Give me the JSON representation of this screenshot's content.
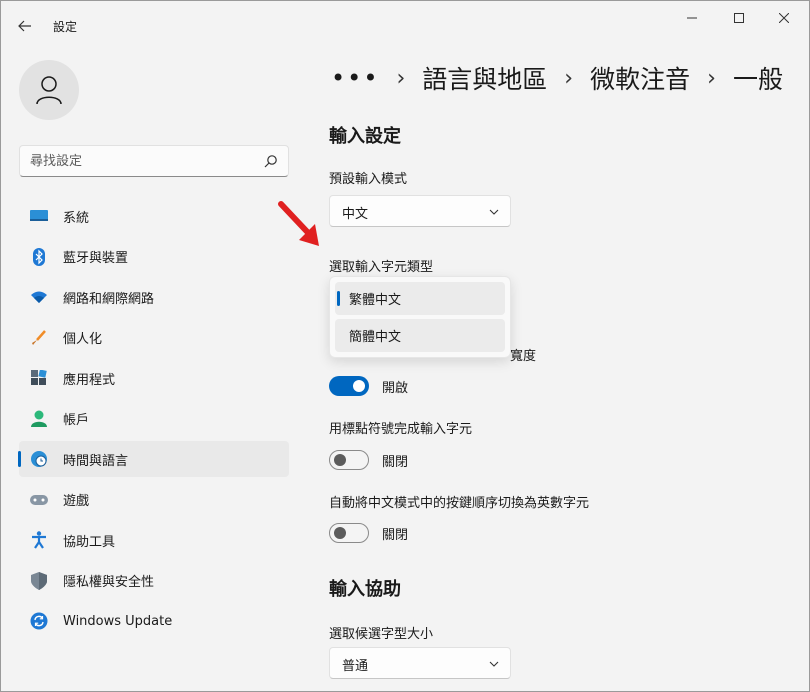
{
  "window": {
    "app_title": "設定",
    "accent": "#0067c0"
  },
  "sidebar": {
    "search_placeholder": "尋找設定",
    "items": [
      {
        "label": "系統",
        "icon": "monitor-icon"
      },
      {
        "label": "藍牙與裝置",
        "icon": "bluetooth-icon"
      },
      {
        "label": "網路和網際網路",
        "icon": "wifi-icon"
      },
      {
        "label": "個人化",
        "icon": "brush-icon"
      },
      {
        "label": "應用程式",
        "icon": "apps-icon"
      },
      {
        "label": "帳戶",
        "icon": "person-icon"
      },
      {
        "label": "時間與語言",
        "icon": "globe-clock-icon",
        "active": true
      },
      {
        "label": "遊戲",
        "icon": "gamepad-icon"
      },
      {
        "label": "協助工具",
        "icon": "accessibility-icon"
      },
      {
        "label": "隱私權與安全性",
        "icon": "shield-icon"
      },
      {
        "label": "Windows Update",
        "icon": "update-icon"
      }
    ]
  },
  "breadcrumb": {
    "ellipsis": "•••",
    "items": [
      "語言與地區",
      "微軟注音",
      "一般"
    ]
  },
  "content": {
    "section1_title": "輸入設定",
    "default_mode_label": "預設輸入模式",
    "default_mode_value": "中文",
    "char_type_label": "選取輸入字元類型",
    "char_type_options": [
      "繁體中文",
      "簡體中文"
    ],
    "char_type_selected": "繁體中文",
    "hidden_setting_peek": "寬度",
    "toggle1_state": "開啟",
    "punct_label": "用標點符號完成輸入字元",
    "toggle2_state": "關閉",
    "auto_switch_label": "自動將中文模式中的按鍵順序切換為英數字元",
    "toggle3_state": "關閉",
    "section2_title": "輸入協助",
    "candidate_size_label": "選取候選字型大小",
    "candidate_size_value": "普通"
  },
  "annotation": {
    "arrow_color": "#e02020"
  }
}
